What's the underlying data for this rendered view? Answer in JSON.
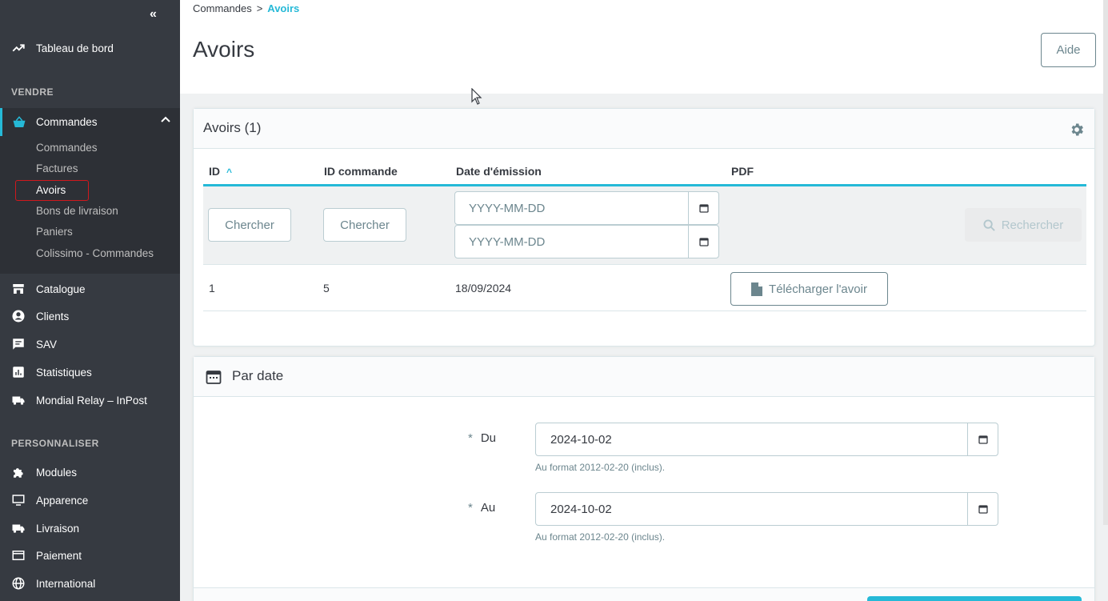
{
  "sidebar": {
    "collapse_label": "«",
    "dashboard": "Tableau de bord",
    "section_sell": "VENDRE",
    "orders": {
      "label": "Commandes",
      "children": [
        "Commandes",
        "Factures",
        "Avoirs",
        "Bons de livraison",
        "Paniers",
        "Colissimo - Commandes"
      ],
      "active_child": "Avoirs"
    },
    "items_sell": [
      "Catalogue",
      "Clients",
      "SAV",
      "Statistiques",
      "Mondial Relay – InPost"
    ],
    "section_customize": "PERSONNALISER",
    "items_customize": [
      "Modules",
      "Apparence",
      "Livraison",
      "Paiement",
      "International"
    ]
  },
  "header": {
    "breadcrumb_parent": "Commandes",
    "breadcrumb_sep": ">",
    "breadcrumb_current": "Avoirs",
    "title": "Avoirs",
    "help_label": "Aide"
  },
  "credit_slips_panel": {
    "title": "Avoirs (1)",
    "columns": [
      "ID",
      "ID commande",
      "Date d'émission",
      "PDF"
    ],
    "sort_indicator": "^",
    "filters": {
      "id_placeholder": "Chercher",
      "order_id_placeholder": "Chercher",
      "date_from_placeholder": "YYYY-MM-DD",
      "date_to_placeholder": "YYYY-MM-DD",
      "search_label": "Rechercher"
    },
    "rows": [
      {
        "id": "1",
        "order_id": "5",
        "date": "18/09/2024",
        "pdf_label": "Télécharger l'avoir"
      }
    ]
  },
  "by_date_panel": {
    "title": "Par date",
    "from_label": "Du",
    "from_value": "2024-10-02",
    "from_help": "Au format 2012-02-20 (inclus).",
    "to_label": "Au",
    "to_value": "2024-10-02",
    "to_help": "Au format 2012-02-20 (inclus).",
    "required_marker": "*"
  },
  "colors": {
    "accent": "#25b9d7",
    "sidebar_bg": "#363a41",
    "active_outline": "#d0181d"
  }
}
